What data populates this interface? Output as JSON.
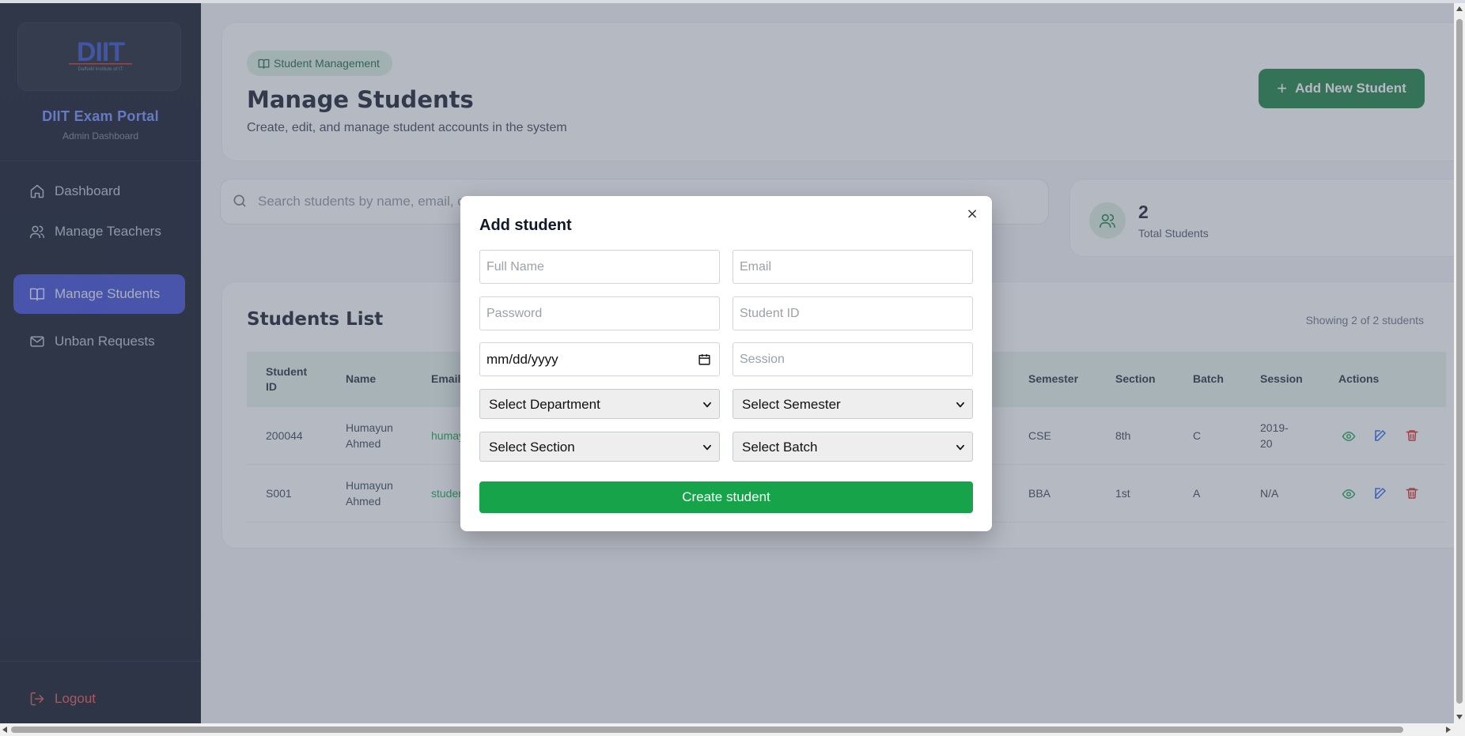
{
  "sidebar": {
    "logo_alt": "DIIT",
    "logo_tagline": "Daffodil Institute of IT",
    "brand_title": "DIIT Exam Portal",
    "brand_subtitle": "Admin Dashboard",
    "items": [
      {
        "label": "Dashboard",
        "icon": "home-icon",
        "active": false
      },
      {
        "label": "Manage Teachers",
        "icon": "users-icon",
        "active": false
      },
      {
        "label": "Manage Students",
        "icon": "book-open-icon",
        "active": true
      },
      {
        "label": "Unban Requests",
        "icon": "mail-icon",
        "active": false
      }
    ],
    "logout_label": "Logout"
  },
  "header": {
    "badge": "Student Management",
    "title": "Manage Students",
    "subtitle": "Create, edit, and manage student accounts in the system",
    "add_button_label": "Add New Student"
  },
  "search": {
    "placeholder": "Search students by name, email, or ID..."
  },
  "stats": {
    "total_value": "2",
    "total_label": "Total Students"
  },
  "students_list": {
    "title": "Students List",
    "count_text": "Showing 2 of 2 students",
    "columns": {
      "student_id": "Student ID",
      "name": "Name",
      "email": "Email",
      "semester": "Semester",
      "section": "Section",
      "batch": "Batch",
      "session": "Session",
      "actions": "Actions"
    },
    "rows": [
      {
        "student_id": "200044",
        "name": "Humayun Ahmed",
        "email": "humay",
        "semester": "CSE",
        "section": "8th",
        "batch": "C",
        "session": "2019-20"
      },
      {
        "student_id": "S001",
        "name": "Humayun Ahmed",
        "email": "studer",
        "semester": "BBA",
        "section": "1st",
        "batch": "A",
        "session": "N/A"
      }
    ]
  },
  "modal": {
    "title": "Add student",
    "close_symbol": "×",
    "fields": {
      "full_name_placeholder": "Full Name",
      "email_placeholder": "Email",
      "password_placeholder": "Password",
      "student_id_placeholder": "Student ID",
      "date_placeholder": "mm/dd/yyyy",
      "session_placeholder": "Session",
      "department_selected": "Select Department",
      "semester_selected": "Select Semester",
      "section_selected": "Select Section",
      "batch_selected": "Select Batch"
    },
    "submit_label": "Create student"
  },
  "colors": {
    "accent_green": "#15803d",
    "active_nav": "#3b47d6",
    "brand_blue": "#6f8bff",
    "logout_red": "#e0534d",
    "delete_red": "#dc2626",
    "edit_blue": "#2563eb"
  }
}
